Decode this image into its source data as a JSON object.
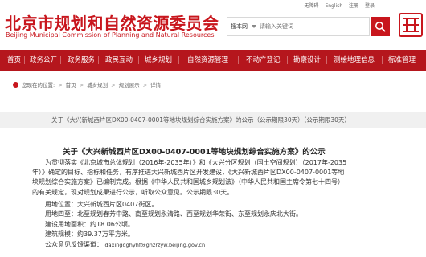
{
  "header": {
    "title_cn": "北京市规划和自然资源委员会",
    "title_en": "Beijing Municipal Commission of Planning and Natural Resources",
    "top_links": [
      "无障碍",
      "English",
      "注册",
      "登录"
    ],
    "search": {
      "scope": "搜本网",
      "placeholder": "请输入关键词"
    },
    "seal_text": "首都规划"
  },
  "nav": {
    "items": [
      "首页",
      "政务公开",
      "政务服务",
      "政民互动",
      "城乡规划",
      "自然资源管理",
      "不动产登记",
      "勘察设计",
      "测绘地理信息",
      "标准管理"
    ]
  },
  "breadcrumb": {
    "prefix": "您现在的位置:",
    "items": [
      "首页",
      "城乡规划",
      "规划展示",
      "详情"
    ]
  },
  "notice": {
    "text": "关于《大兴新城西片区DX00-0407-0001等地块规划综合实施方案》的公示（公示期限30天）（公示期限30天）"
  },
  "article": {
    "title": "关于《大兴新城西片区DX00-0407-0001等地块规划综合实施方案》的公示",
    "paragraph_lines": [
      "为贯彻落实《北京城市总体规划（2016年-2035年）》和《大兴分区规划（国土空间规划）（2017年-2035",
      "年）》确定的目标、指标和任务，有序推进大兴新城西片区开发建设，《大兴新城西片区DX00-0407-0001等地",
      "块规划综合实施方案》已编制完成。根据《中华人民共和国城乡规划法》（中华人民共和国主席令第七十四号）",
      "的有关规定，现对规划成果进行公示，听取公众意见。公示期限30天。"
    ],
    "location": "用地位置：大兴新城西片区0407街区。",
    "boundary": "用地四至：北至规划春芳中路、南至规划永清路、西至规划华荣街、东至规划永庆北大街。",
    "land_area": "建设用地面积：约18.06公顷。",
    "building_area": "建筑规模：约39.37万平方米。",
    "feedback_label": "公众意见反馈渠道：",
    "feedback_email": "daxingdghyhf@ghzrzyw.beijing.gov.cn"
  }
}
